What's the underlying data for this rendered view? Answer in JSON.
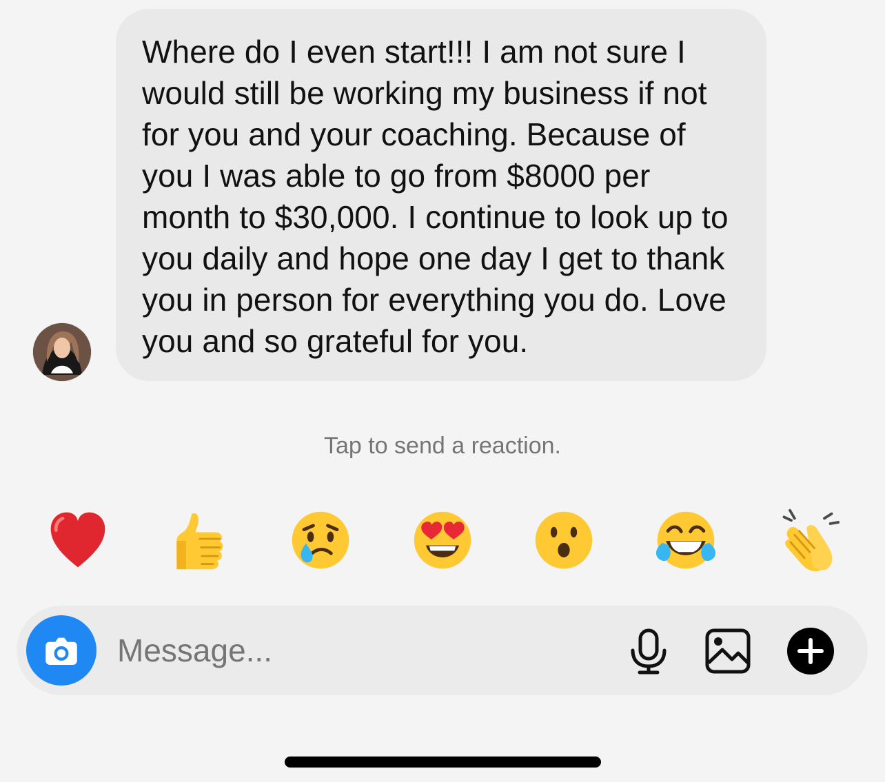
{
  "message": {
    "text": "Where do I even start!!! I am not sure I would still be working my business if not for you and your coaching. Because of you I was able to go from $8000 per month to $30,000. I continue to look up to you daily and hope one day I get to thank you in person for everything you do. Love you and so grateful for you."
  },
  "reaction_hint": "Tap to send a reaction.",
  "reactions": [
    {
      "name": "heart"
    },
    {
      "name": "thumbs-up"
    },
    {
      "name": "crying-face"
    },
    {
      "name": "heart-eyes"
    },
    {
      "name": "surprised-face"
    },
    {
      "name": "laughing-tears"
    },
    {
      "name": "clapping-hands"
    }
  ],
  "composer": {
    "placeholder": "Message...",
    "icons": [
      "camera-icon",
      "microphone-icon",
      "gallery-icon",
      "plus-icon"
    ]
  },
  "colors": {
    "background": "#f4f4f4",
    "bubble": "#e9e9e9",
    "camera": "#1f88f2",
    "text": "#111111",
    "secondary_text": "#757575"
  }
}
